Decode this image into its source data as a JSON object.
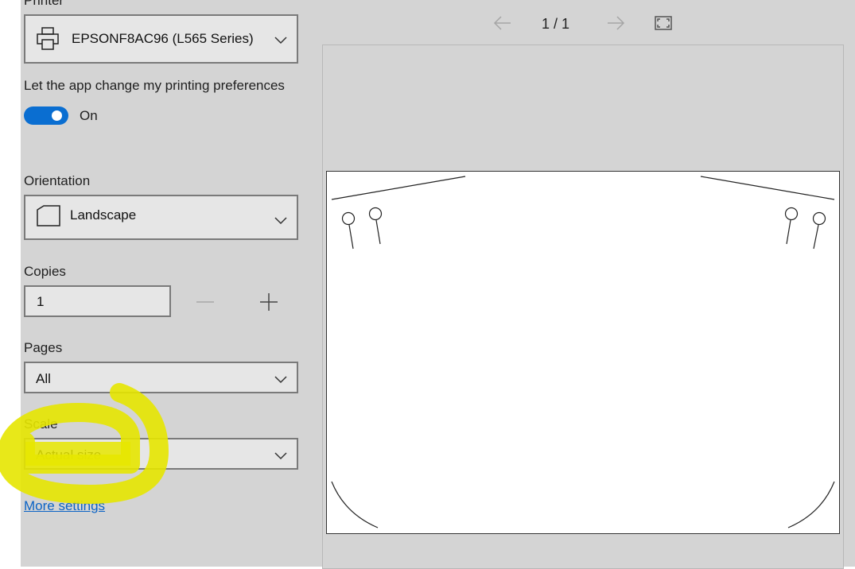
{
  "printer": {
    "label": "Printer",
    "selected": "EPSONF8AC96 (L565 Series)",
    "icon": "printer-icon"
  },
  "preferences": {
    "label": "Let the app change my printing preferences",
    "toggle_state": "On",
    "toggle_on": true
  },
  "orientation": {
    "label": "Orientation",
    "selected": "Landscape",
    "icon": "page-landscape-icon"
  },
  "copies": {
    "label": "Copies",
    "value": "1"
  },
  "pages": {
    "label": "Pages",
    "selected": "All"
  },
  "scale": {
    "label": "Scale",
    "selected": "Actual size"
  },
  "links": {
    "more_settings": "More settings"
  },
  "preview": {
    "page_indicator": "1 / 1"
  },
  "colors": {
    "accent": "#0a6ed1",
    "link": "#0b63c5",
    "panel_bg": "#d4d4d4",
    "highlight": "#e6e600"
  }
}
